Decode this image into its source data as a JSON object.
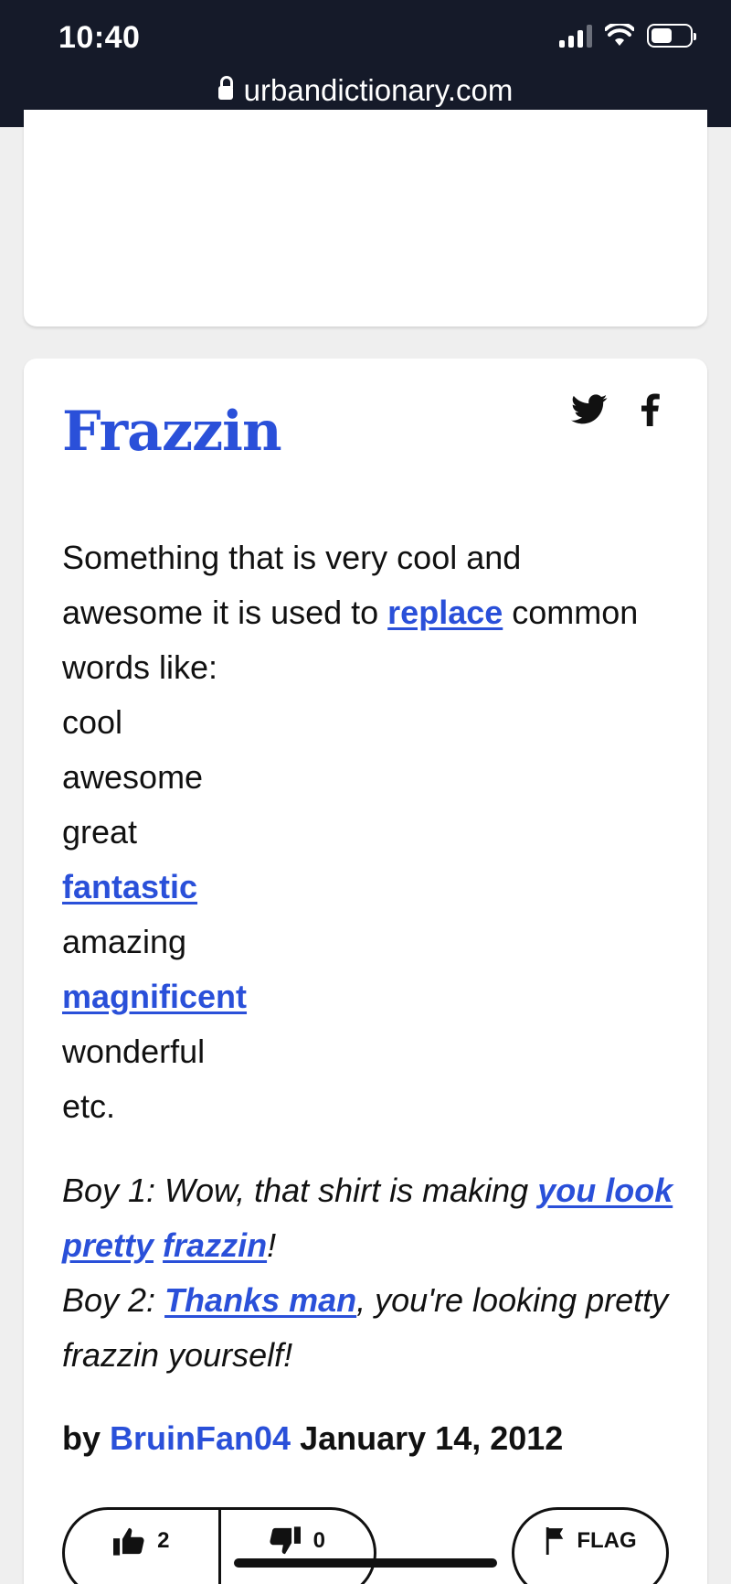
{
  "status_bar": {
    "time": "10:40",
    "url": "urbandictionary.com"
  },
  "definition": {
    "word": "Frazzin",
    "meaning_lines": [
      [
        {
          "text": "Something that is very cool and"
        }
      ],
      [
        {
          "text": "awesome it is used to "
        },
        {
          "text": "replace",
          "link": true
        },
        {
          "text": " common"
        }
      ],
      [
        {
          "text": "words like:"
        }
      ],
      [
        {
          "text": "cool"
        }
      ],
      [
        {
          "text": "awesome"
        }
      ],
      [
        {
          "text": "great"
        }
      ],
      [
        {
          "text": "fantastic",
          "link": true
        }
      ],
      [
        {
          "text": "amazing"
        }
      ],
      [
        {
          "text": "magnificent",
          "link": true
        }
      ],
      [
        {
          "text": "wonderful"
        }
      ],
      [
        {
          "text": "etc."
        }
      ]
    ],
    "example_lines": [
      [
        {
          "text": "Boy 1: Wow, that shirt is making "
        },
        {
          "text": "you look",
          "link": true
        }
      ],
      [
        {
          "text": "pretty",
          "link": true
        },
        {
          "text": " "
        },
        {
          "text": "frazzin",
          "link": true
        },
        {
          "text": "!"
        }
      ],
      [
        {
          "text": "Boy 2: "
        },
        {
          "text": "Thanks man",
          "link": true
        },
        {
          "text": ", you're looking pretty"
        }
      ],
      [
        {
          "text": "frazzin yourself!"
        }
      ]
    ],
    "by_label": "by",
    "author": "BruinFan04",
    "date": "January 14, 2012",
    "upvotes": "2",
    "downvotes": "0",
    "flag_label": "FLAG"
  },
  "icons": {
    "share_twitter": "twitter-bird-icon",
    "share_facebook": "facebook-f-icon",
    "thumbs_up": "thumbs-up-icon",
    "thumbs_down": "thumbs-down-icon",
    "flag": "flag-icon"
  },
  "colors": {
    "link": "#2a50d9",
    "status_bar": "#151a29",
    "page_bg": "#efefef"
  }
}
